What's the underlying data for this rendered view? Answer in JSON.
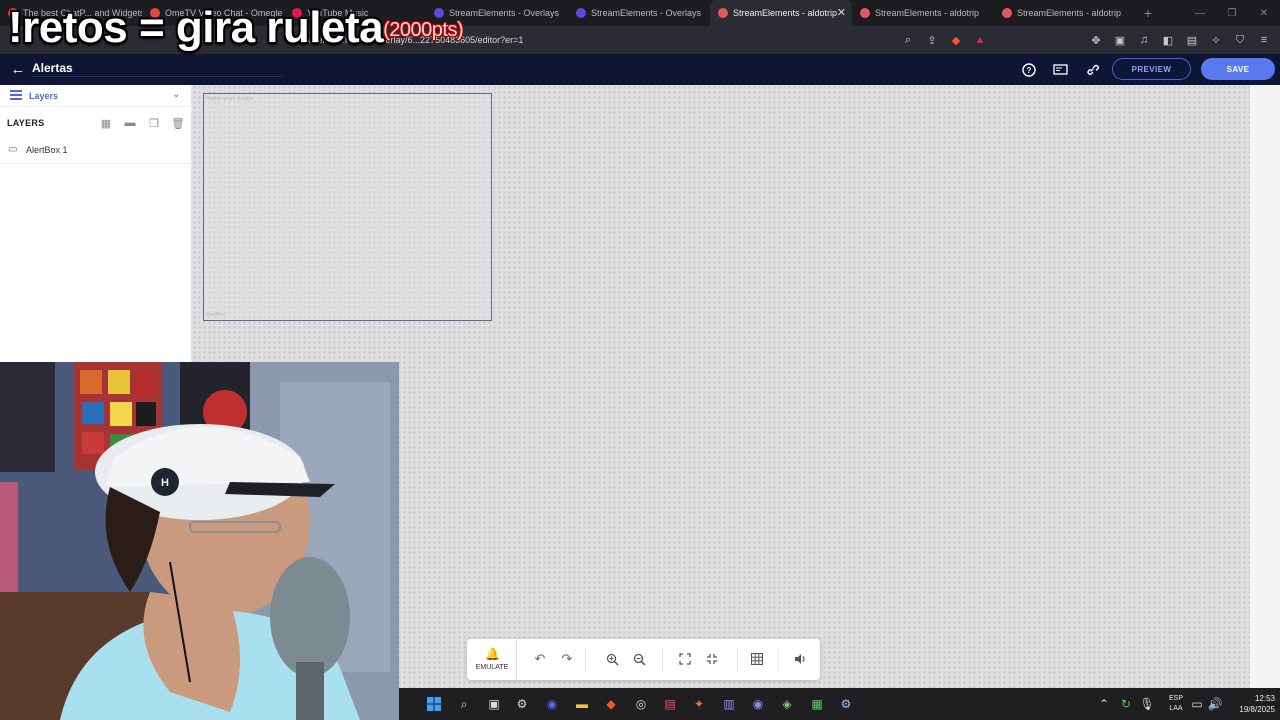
{
  "browser": {
    "tabs": [
      {
        "label": "The best ChatP... and Widgets",
        "color": "#d33b3b"
      },
      {
        "label": "OmeTV Video Chat - Omegle",
        "color": "#e04646"
      },
      {
        "label": "YouTube Music",
        "color": "#e3174d"
      },
      {
        "label": "StreamElements - Overlays",
        "color": "#5b4be0"
      },
      {
        "label": "StreamElements - Overlays",
        "color": "#5b4be0"
      },
      {
        "label": "StreamElements - aldotrip",
        "color": "#e05a5a",
        "active": true
      },
      {
        "label": "StreamElements - aldotrip",
        "color": "#e05a5a"
      },
      {
        "label": "StreamElements - aldotrip",
        "color": "#e05a5a"
      }
    ],
    "url": "streamelements.com/overlay/6...22750483605/editor?er=1"
  },
  "caption": {
    "text": "!retos = gira ruleta",
    "pts": "(2000pts)"
  },
  "app": {
    "title": "Alertas",
    "preview_label": "PREVIEW",
    "save_label": "SAVE"
  },
  "panel": {
    "header": "Layers",
    "title": "LAYERS",
    "layers": [
      {
        "name": "AlertBox 1"
      }
    ]
  },
  "canvas": {
    "alertbox_hint": "Hidden when inactive",
    "alertbox_tag": "AlertBox"
  },
  "toolbar": {
    "emulate_label": "EMULATE"
  },
  "taskbar": {
    "lang_top": "ESP",
    "lang_bottom": "LAA",
    "time": "12:53",
    "date": "19/8/2025"
  },
  "colors": {
    "accent": "#5a79ee",
    "header_bg": "#0f1535",
    "canvas_bg": "#dedede"
  }
}
